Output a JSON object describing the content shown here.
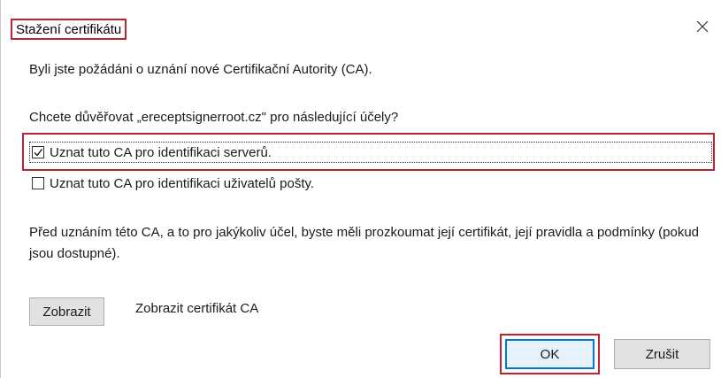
{
  "window": {
    "title": "Stažení certifikátu",
    "close_icon": "close-icon"
  },
  "body": {
    "intro": "Byli jste požádáni o uznání nové Certifikační Autority (CA).",
    "question": "Chcete důvěřovat „ereceptsignerroot.cz\" pro následující účely?",
    "options": [
      {
        "label": "Uznat tuto CA pro identifikaci serverů.",
        "checked": true
      },
      {
        "label": "Uznat tuto CA pro identifikaci uživatelů pošty.",
        "checked": false
      }
    ],
    "warning": "Před uznáním této CA, a to pro jakýkoliv účel, byste měli prozkoumat její certifikát, její pravidla a podmínky (pokud jsou dostupné)."
  },
  "view": {
    "button_label": "Zobrazit",
    "description": "Zobrazit certifikát CA"
  },
  "footer": {
    "ok_label": "OK",
    "cancel_label": "Zrušit"
  },
  "colors": {
    "highlight": "#c0212f",
    "focus_border": "#0078d7",
    "button_bg": "#e1e1e1"
  }
}
